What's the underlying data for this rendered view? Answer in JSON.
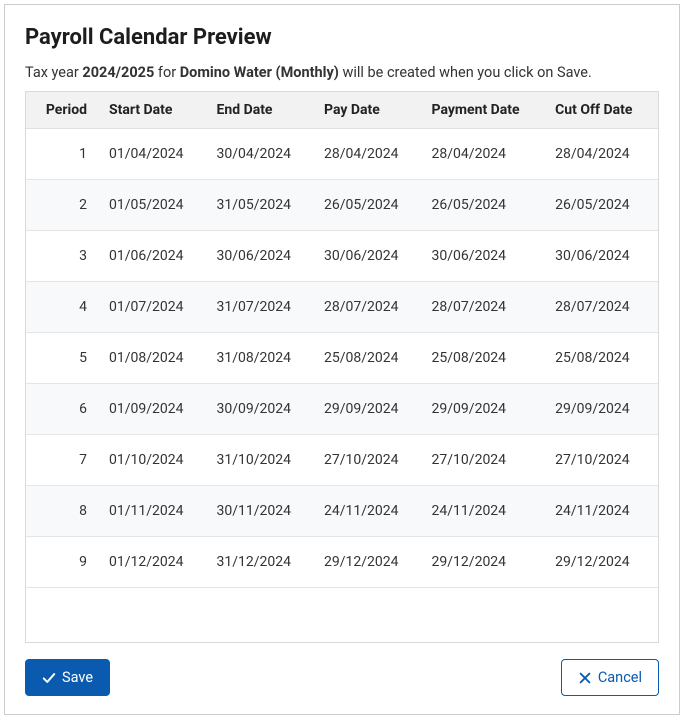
{
  "title": "Payroll Calendar Preview",
  "subtitle": {
    "prefix": "Tax year ",
    "tax_year": "2024/2025",
    "mid": " for ",
    "company": "Domino Water (Monthly)",
    "suffix": " will be created when you click on Save."
  },
  "table": {
    "headers": [
      "Period",
      "Start Date",
      "End Date",
      "Pay Date",
      "Payment Date",
      "Cut Off Date"
    ],
    "rows": [
      {
        "period": "1",
        "start": "01/04/2024",
        "end": "30/04/2024",
        "pay": "28/04/2024",
        "payment": "28/04/2024",
        "cutoff": "28/04/2024"
      },
      {
        "period": "2",
        "start": "01/05/2024",
        "end": "31/05/2024",
        "pay": "26/05/2024",
        "payment": "26/05/2024",
        "cutoff": "26/05/2024"
      },
      {
        "period": "3",
        "start": "01/06/2024",
        "end": "30/06/2024",
        "pay": "30/06/2024",
        "payment": "30/06/2024",
        "cutoff": "30/06/2024"
      },
      {
        "period": "4",
        "start": "01/07/2024",
        "end": "31/07/2024",
        "pay": "28/07/2024",
        "payment": "28/07/2024",
        "cutoff": "28/07/2024"
      },
      {
        "period": "5",
        "start": "01/08/2024",
        "end": "31/08/2024",
        "pay": "25/08/2024",
        "payment": "25/08/2024",
        "cutoff": "25/08/2024"
      },
      {
        "period": "6",
        "start": "01/09/2024",
        "end": "30/09/2024",
        "pay": "29/09/2024",
        "payment": "29/09/2024",
        "cutoff": "29/09/2024"
      },
      {
        "period": "7",
        "start": "01/10/2024",
        "end": "31/10/2024",
        "pay": "27/10/2024",
        "payment": "27/10/2024",
        "cutoff": "27/10/2024"
      },
      {
        "period": "8",
        "start": "01/11/2024",
        "end": "30/11/2024",
        "pay": "24/11/2024",
        "payment": "24/11/2024",
        "cutoff": "24/11/2024"
      },
      {
        "period": "9",
        "start": "01/12/2024",
        "end": "31/12/2024",
        "pay": "29/12/2024",
        "payment": "29/12/2024",
        "cutoff": "29/12/2024"
      }
    ]
  },
  "buttons": {
    "save": "Save",
    "cancel": "Cancel"
  }
}
